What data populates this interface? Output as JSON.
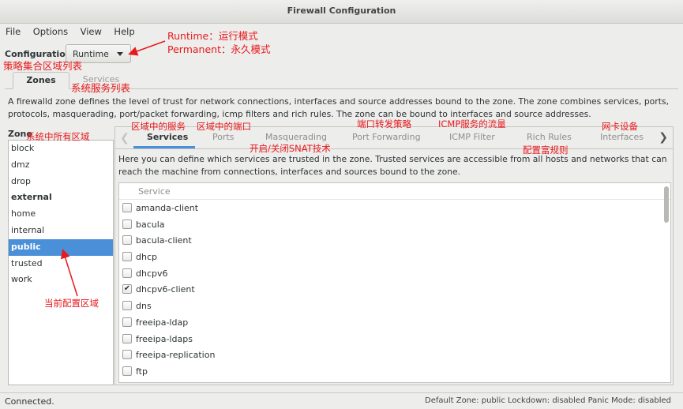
{
  "window": {
    "title": "Firewall Configuration"
  },
  "menu": {
    "file": "File",
    "options": "Options",
    "view": "View",
    "help": "Help"
  },
  "configuration": {
    "label": "Configuration:",
    "value": "Runtime"
  },
  "outer_tabs": {
    "zones": "Zones",
    "services": "Services"
  },
  "zone_description": "A firewalld zone defines the level of trust for network connections, interfaces and source addresses bound to the zone. The zone combines services, ports, protocols, masquerading, port/packet forwarding, icmp filters and rich rules. The zone can be bound to interfaces and source addresses.",
  "zone_section_label": "Zone",
  "zones": [
    "block",
    "dmz",
    "drop",
    "external",
    "home",
    "internal",
    "public",
    "trusted",
    "work"
  ],
  "selected_zone": "public",
  "inner_tabs": [
    "Services",
    "Ports",
    "Masquerading",
    "Port Forwarding",
    "ICMP Filter",
    "Rich Rules",
    "Interfaces"
  ],
  "services_description": "Here you can define which services are trusted in the zone. Trusted services are accessible from all hosts and networks that can reach the machine from connections, interfaces and sources bound to the zone.",
  "services_header": "Service",
  "services": [
    {
      "name": "amanda-client",
      "checked": false
    },
    {
      "name": "bacula",
      "checked": false
    },
    {
      "name": "bacula-client",
      "checked": false
    },
    {
      "name": "dhcp",
      "checked": false
    },
    {
      "name": "dhcpv6",
      "checked": false
    },
    {
      "name": "dhcpv6-client",
      "checked": true
    },
    {
      "name": "dns",
      "checked": false
    },
    {
      "name": "freeipa-ldap",
      "checked": false
    },
    {
      "name": "freeipa-ldaps",
      "checked": false
    },
    {
      "name": "freeipa-replication",
      "checked": false
    },
    {
      "name": "ftp",
      "checked": false
    }
  ],
  "status": {
    "left": "Connected.",
    "right": "Default Zone: public  Lockdown: disabled  Panic Mode: disabled"
  },
  "annotations": {
    "runtime": "Runtime：运行模式",
    "permanent": "Permanent：永久模式",
    "zone_list": "策略集合区域列表",
    "services_list": "系统服务列表",
    "all_zones": "系统中所有区域",
    "zone_services": "区域中的服务",
    "zone_ports": "区域中的端口",
    "port_forward": "端口转发策略",
    "icmp_traffic": "ICMP服务的流量",
    "nic": "网卡设备",
    "snat": "开启/关闭SNAT技术",
    "rich_rules": "配置富规则",
    "current_zone": "当前配置区域"
  },
  "colors": {
    "selection": "#4a90d9",
    "annotation": "#e8191d"
  }
}
